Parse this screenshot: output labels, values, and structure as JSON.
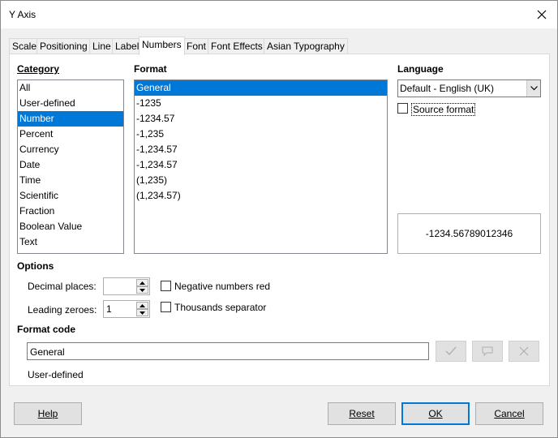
{
  "window": {
    "title": "Y Axis"
  },
  "tabs": [
    {
      "label": "Scale"
    },
    {
      "label": "Positioning"
    },
    {
      "label": "Line"
    },
    {
      "label": "Label"
    },
    {
      "label": "Numbers",
      "active": true
    },
    {
      "label": "Font"
    },
    {
      "label": "Font Effects"
    },
    {
      "label": "Asian Typography"
    }
  ],
  "category": {
    "label": "Category",
    "items": [
      "All",
      "User-defined",
      "Number",
      "Percent",
      "Currency",
      "Date",
      "Time",
      "Scientific",
      "Fraction",
      "Boolean Value",
      "Text"
    ],
    "selected": "Number"
  },
  "format": {
    "label": "Format",
    "items": [
      "General",
      "-1235",
      "-1234.57",
      "-1,235",
      "-1,234.57",
      "-1,234.57",
      "(1,235)",
      "(1,234.57)"
    ],
    "selected": "General"
  },
  "language": {
    "label": "Language",
    "value": "Default - English (UK)",
    "source_format_label": "Source format",
    "source_format_checked": false
  },
  "preview": {
    "value": "-1234.56789012346"
  },
  "options": {
    "label": "Options",
    "decimal_places_label": "Decimal places:",
    "decimal_places_value": "",
    "leading_zeroes_label": "Leading zeroes:",
    "leading_zeroes_value": "1",
    "negative_red_label": "Negative numbers red",
    "negative_red_checked": false,
    "thousands_sep_label": "Thousands separator",
    "thousands_sep_checked": false
  },
  "format_code": {
    "label": "Format code",
    "value": "General",
    "status": "User-defined"
  },
  "buttons": {
    "help": "Help",
    "reset": "Reset",
    "ok": "OK",
    "cancel": "Cancel"
  },
  "colors": {
    "selection": "#0078d7",
    "default_button_border": "#0078d7"
  }
}
